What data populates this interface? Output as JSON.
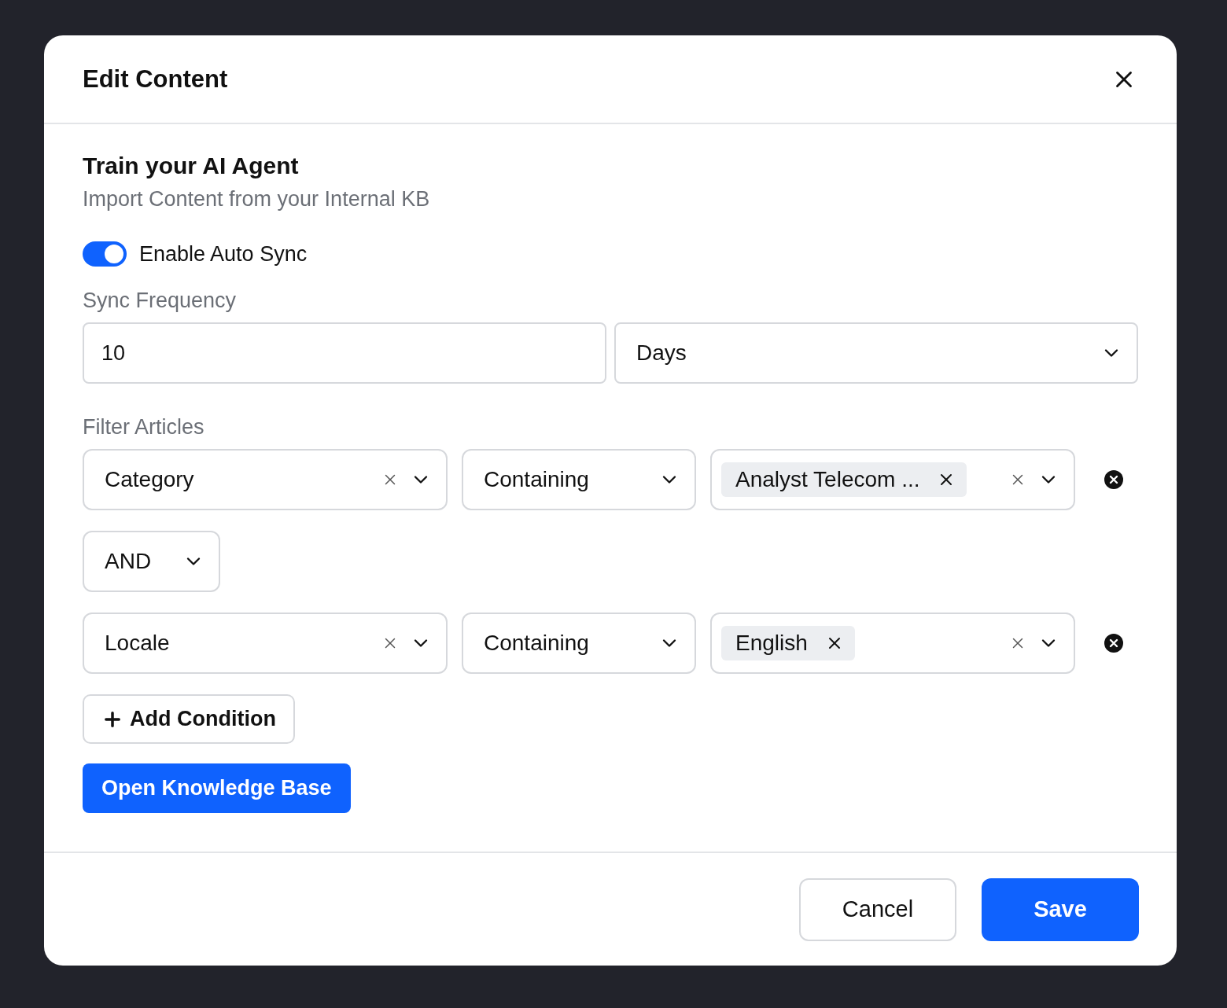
{
  "dialog": {
    "title": "Edit Content"
  },
  "section": {
    "title": "Train your AI Agent",
    "subtitle": "Import Content from your Internal KB"
  },
  "auto_sync": {
    "label": "Enable Auto Sync",
    "on": true
  },
  "sync_frequency": {
    "label": "Sync Frequency",
    "value": "10",
    "unit": "Days"
  },
  "filter": {
    "label": "Filter Articles",
    "rows": [
      {
        "kind": "condition",
        "field": "Category",
        "operator": "Containing",
        "tags": [
          "Analyst Telecom ..."
        ]
      },
      {
        "kind": "connector",
        "value": "AND"
      },
      {
        "kind": "condition",
        "field": "Locale",
        "operator": "Containing",
        "tags": [
          "English"
        ]
      }
    ]
  },
  "add_condition": "Add Condition",
  "open_kb": "Open Knowledge Base",
  "footer_buttons": [
    {
      "label": "Cancel",
      "kind": "secondary"
    },
    {
      "label": "Save",
      "kind": "primary"
    }
  ]
}
